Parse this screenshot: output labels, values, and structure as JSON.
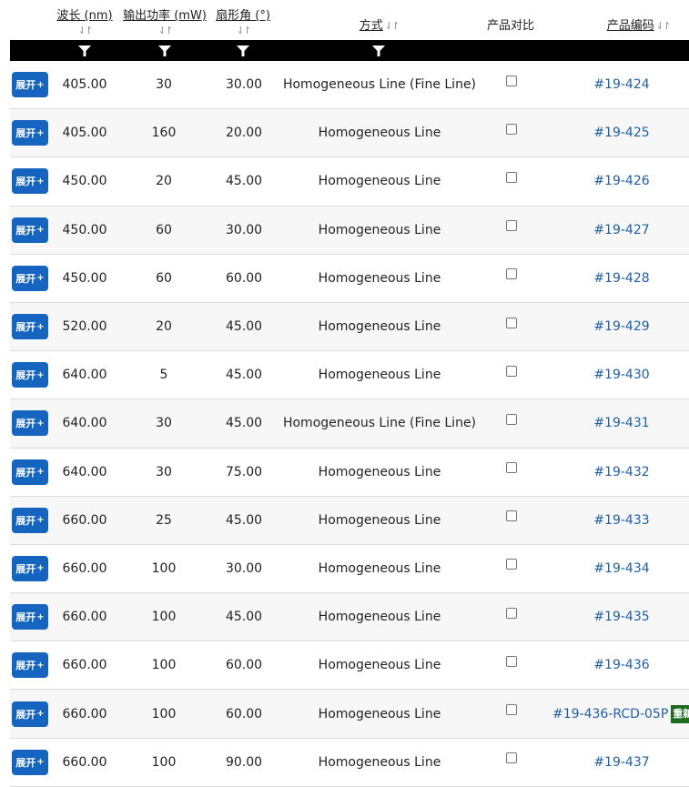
{
  "headers": {
    "wavelength": "波长 (nm)",
    "power": "输出功率 (mW)",
    "fan_angle": "扇形角 (°)",
    "method": "方式",
    "compare": "产品对比",
    "part": "产品编码"
  },
  "sort_glyph": "⇃↾",
  "expand_label": "展开",
  "expand_plus": "+",
  "badge_label": "重新",
  "colors": {
    "filter_bar": "#000000",
    "expand_button": "#1565c0",
    "link": "#1f5fa3",
    "badge": "#1d6b1d"
  },
  "rows": [
    {
      "wavelength": "405.00",
      "power": "30",
      "angle": "30.00",
      "method": "Homogeneous Line (Fine Line)",
      "part": "#19-424"
    },
    {
      "wavelength": "405.00",
      "power": "160",
      "angle": "20.00",
      "method": "Homogeneous Line",
      "part": "#19-425"
    },
    {
      "wavelength": "450.00",
      "power": "20",
      "angle": "45.00",
      "method": "Homogeneous Line",
      "part": "#19-426"
    },
    {
      "wavelength": "450.00",
      "power": "60",
      "angle": "30.00",
      "method": "Homogeneous Line",
      "part": "#19-427"
    },
    {
      "wavelength": "450.00",
      "power": "60",
      "angle": "60.00",
      "method": "Homogeneous Line",
      "part": "#19-428"
    },
    {
      "wavelength": "520.00",
      "power": "20",
      "angle": "45.00",
      "method": "Homogeneous Line",
      "part": "#19-429"
    },
    {
      "wavelength": "640.00",
      "power": "5",
      "angle": "45.00",
      "method": "Homogeneous Line",
      "part": "#19-430"
    },
    {
      "wavelength": "640.00",
      "power": "30",
      "angle": "45.00",
      "method": "Homogeneous Line (Fine Line)",
      "part": "#19-431"
    },
    {
      "wavelength": "640.00",
      "power": "30",
      "angle": "75.00",
      "method": "Homogeneous Line",
      "part": "#19-432"
    },
    {
      "wavelength": "660.00",
      "power": "25",
      "angle": "45.00",
      "method": "Homogeneous Line",
      "part": "#19-433"
    },
    {
      "wavelength": "660.00",
      "power": "100",
      "angle": "30.00",
      "method": "Homogeneous Line",
      "part": "#19-434"
    },
    {
      "wavelength": "660.00",
      "power": "100",
      "angle": "45.00",
      "method": "Homogeneous Line",
      "part": "#19-435"
    },
    {
      "wavelength": "660.00",
      "power": "100",
      "angle": "60.00",
      "method": "Homogeneous Line",
      "part": "#19-436"
    },
    {
      "wavelength": "660.00",
      "power": "100",
      "angle": "60.00",
      "method": "Homogeneous Line",
      "part": "#19-436-RCD-05P",
      "badge": true
    },
    {
      "wavelength": "660.00",
      "power": "100",
      "angle": "90.00",
      "method": "Homogeneous Line",
      "part": "#19-437"
    }
  ]
}
